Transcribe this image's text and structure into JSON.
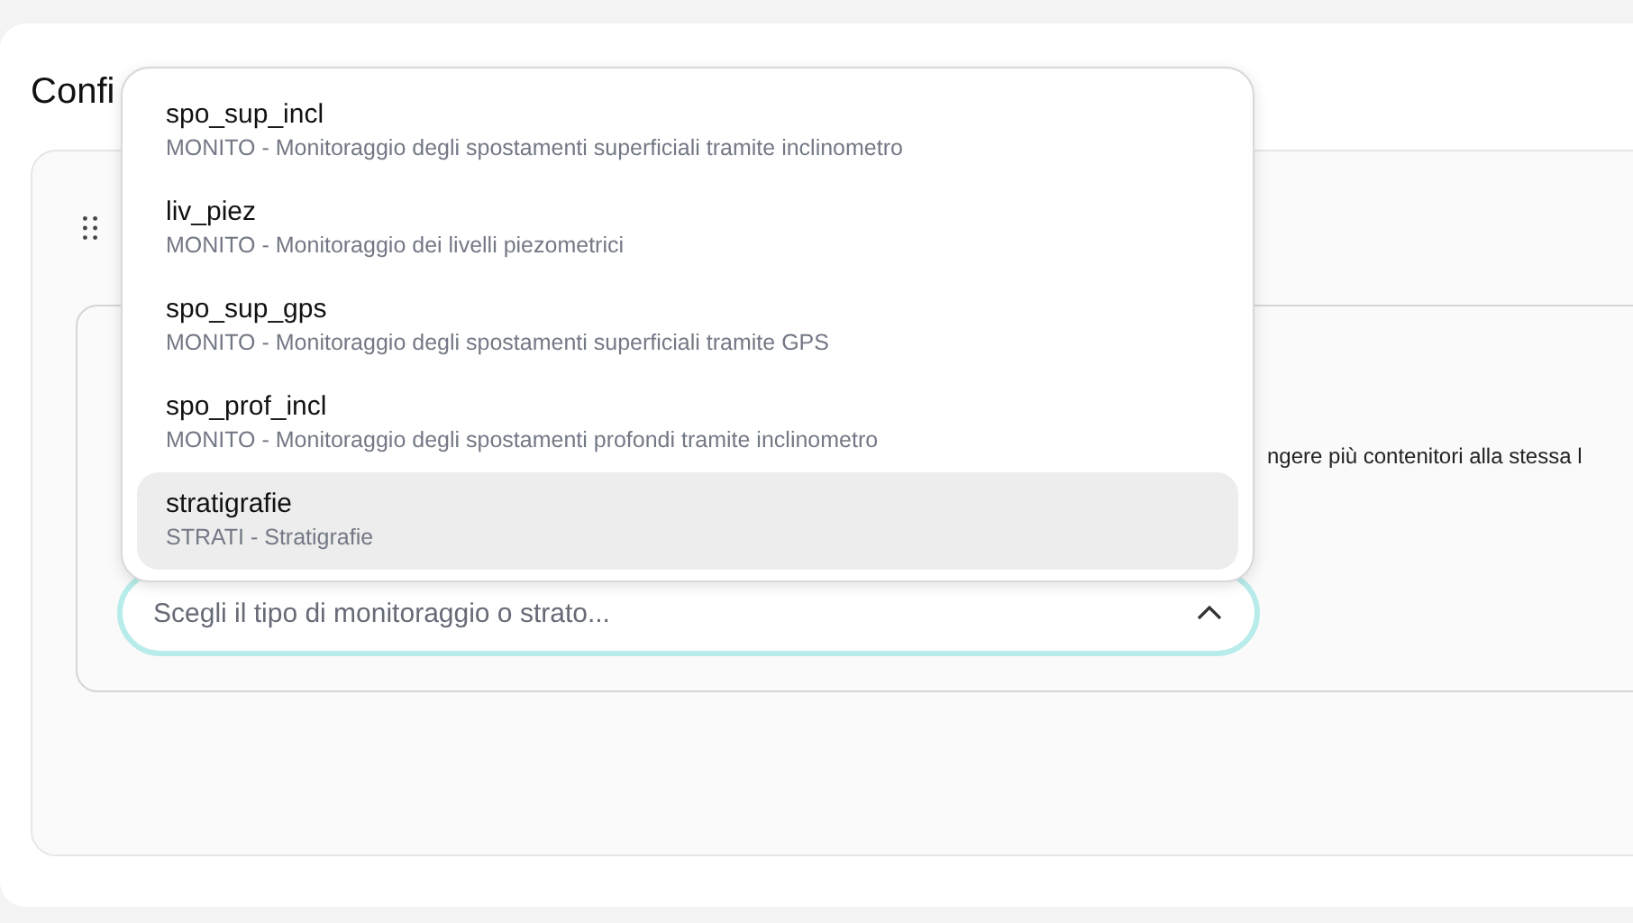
{
  "page": {
    "title": "Confi"
  },
  "panel": {
    "hint_text": "ngere più contenitori alla stessa l"
  },
  "select": {
    "placeholder": "Scegli il tipo di monitoraggio o strato...",
    "expanded": true,
    "options": [
      {
        "code": "spo_sup_incl",
        "description": "MONITO - Monitoraggio degli spostamenti superficiali tramite inclinometro",
        "selected": false
      },
      {
        "code": "liv_piez",
        "description": "MONITO - Monitoraggio dei livelli piezometrici",
        "selected": false
      },
      {
        "code": "spo_sup_gps",
        "description": "MONITO - Monitoraggio degli spostamenti superficiali tramite GPS",
        "selected": false
      },
      {
        "code": "spo_prof_incl",
        "description": "MONITO - Monitoraggio degli spostamenti profondi tramite inclinometro",
        "selected": false
      },
      {
        "code": "stratigrafie",
        "description": "STRATI - Stratigrafie",
        "selected": true
      }
    ]
  }
}
